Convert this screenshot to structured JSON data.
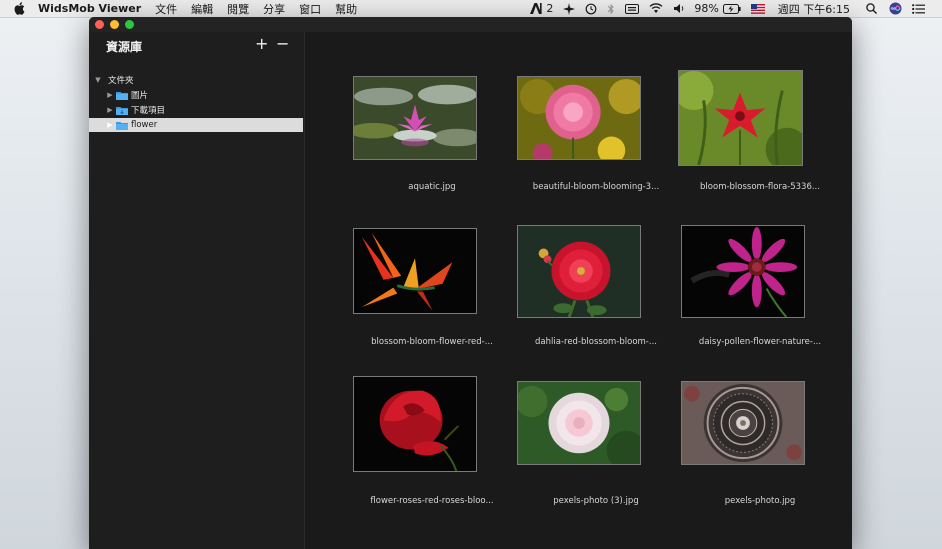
{
  "menubar": {
    "app_name": "WidsMob Viewer",
    "menus": [
      "文件",
      "編輯",
      "閱覽",
      "分享",
      "窗口",
      "幫助"
    ],
    "status": {
      "adobe_count": "2",
      "battery": "98%",
      "clock": "週四 下午6:15"
    }
  },
  "sidebar": {
    "title": "資源庫",
    "add_label": "+",
    "remove_label": "−",
    "root": "文件夾",
    "folders": [
      {
        "label": "圖片"
      },
      {
        "label": "下載項目"
      },
      {
        "label": "flower"
      }
    ],
    "folder_color": "#3b9be0"
  },
  "grid": {
    "items": [
      {
        "caption": "aquatic.jpg"
      },
      {
        "caption": "beautiful-bloom-blooming-3..."
      },
      {
        "caption": "bloom-blossom-flora-5336..."
      },
      {
        "caption": "blossom-bloom-flower-red-..."
      },
      {
        "caption": "dahlia-red-blossom-bloom-..."
      },
      {
        "caption": "daisy-pollen-flower-nature-..."
      },
      {
        "caption": "flower-roses-red-roses-bloo..."
      },
      {
        "caption": "pexels-photo (3).jpg"
      },
      {
        "caption": "pexels-photo.jpg"
      }
    ]
  },
  "colors": {
    "window_bg": "#1a1a1a",
    "selection": "#dcdcdc",
    "close": "#ff5f57",
    "minimize": "#febc2e",
    "maximize": "#28c840"
  }
}
